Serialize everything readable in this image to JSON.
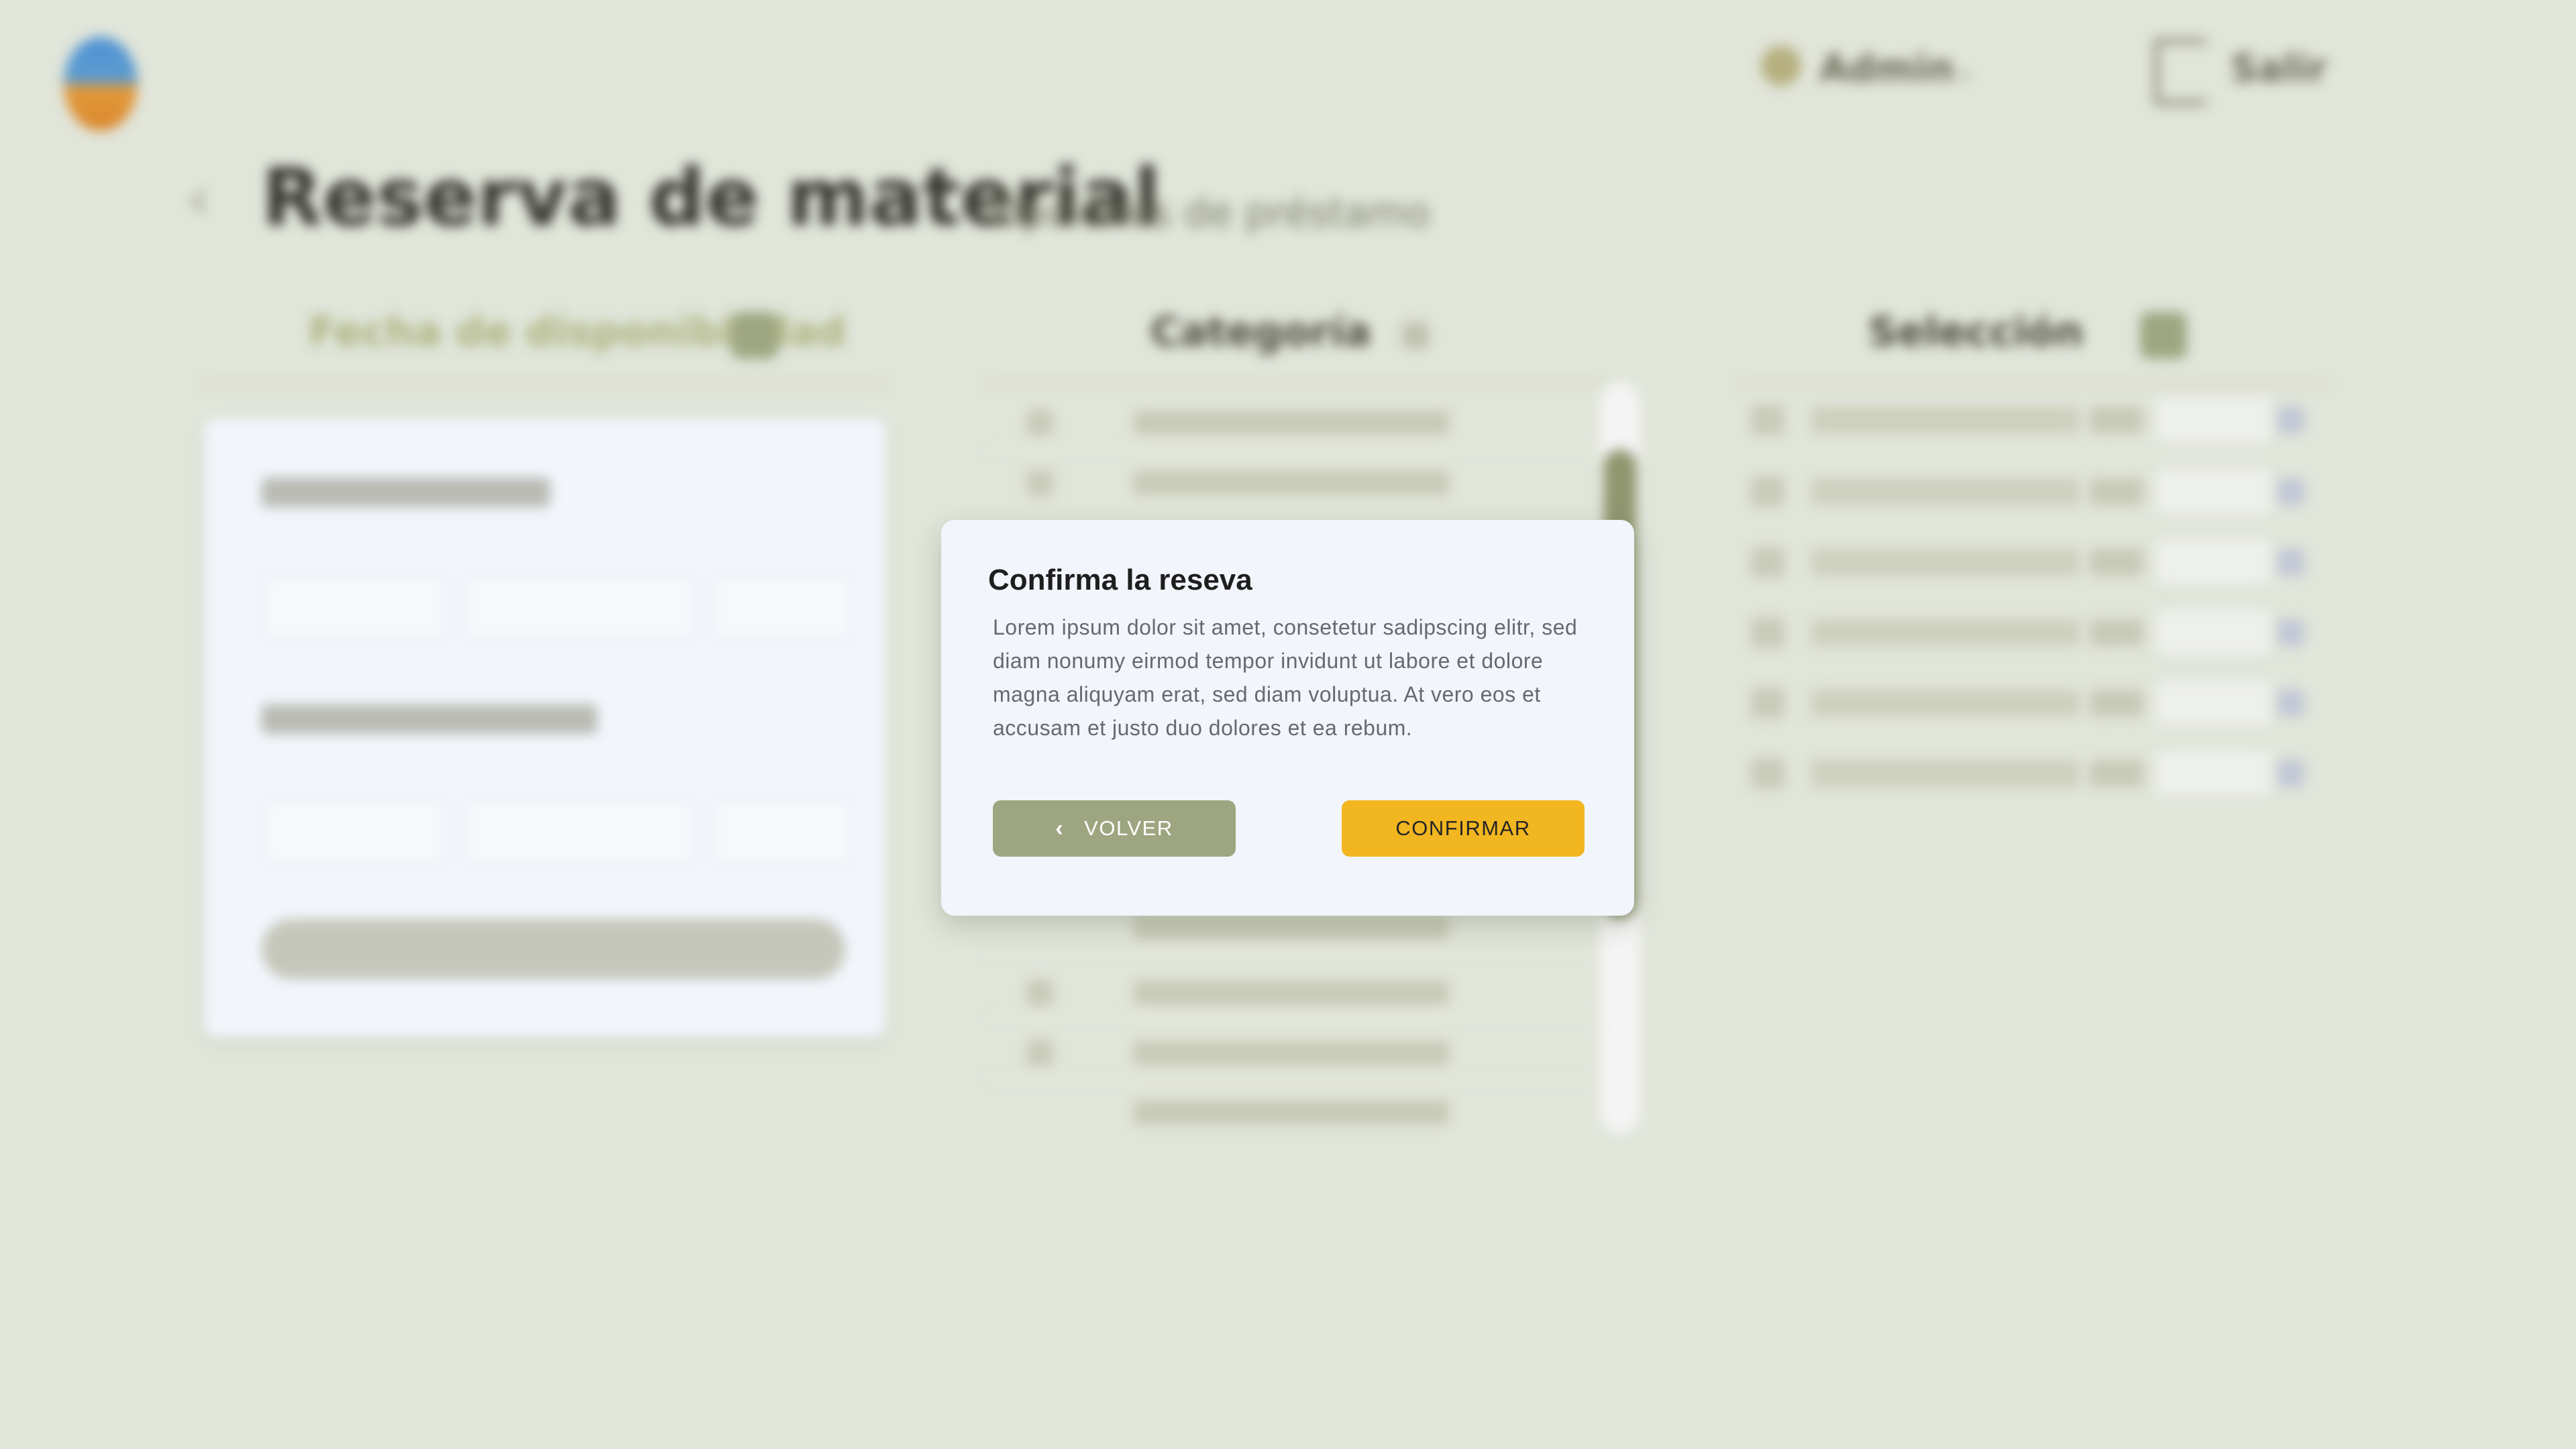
{
  "header": {
    "user_name": "Admin",
    "logout_label": "Salir"
  },
  "page": {
    "title": "Reserva de material",
    "subtitle": "Opciones de préstamo"
  },
  "columns": {
    "filters_title": "Fecha de disponibilidad",
    "category_title": "Categoría",
    "selection_title": "Selección"
  },
  "modal": {
    "title": "Confirma la reseva",
    "body": "Lorem ipsum dolor sit amet, consetetur sadipscing elitr, sed diam nonumy eirmod tempor invidunt ut labore et dolore magna aliquyam erat, sed diam voluptua. At vero eos et accusam et justo duo dolores et ea rebum.",
    "back_label": "VOLVER",
    "confirm_label": "CONFIRMAR"
  },
  "colors": {
    "background": "#e1e5da",
    "primary_olive": "#9ea681",
    "accent_yellow": "#f1b620",
    "modal_bg": "#f2f5fb"
  }
}
